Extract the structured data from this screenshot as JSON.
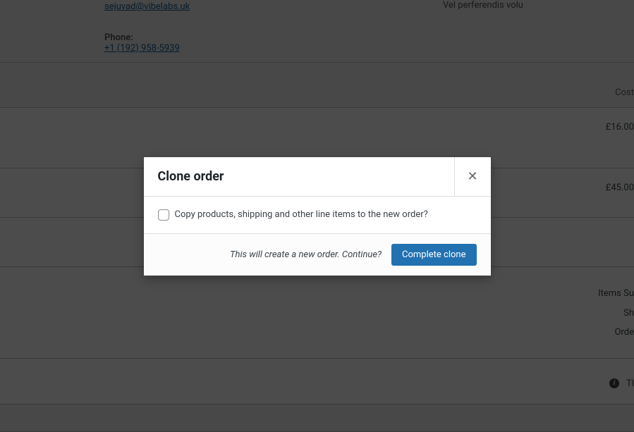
{
  "contact": {
    "email": "sejuvad@vibelabs.uk",
    "phone_label": "Phone:",
    "phone": "+1 (192) 958-5939",
    "note": "Vel perferendis volu"
  },
  "table": {
    "cost_header": "Cost",
    "price1": "£16.00",
    "price2": "£45.00"
  },
  "summary": {
    "line1": "Items Su",
    "line2": "Sh",
    "line3": "Orde"
  },
  "footer": {
    "text": "Tl"
  },
  "modal": {
    "title": "Clone order",
    "checkbox_label": "Copy products, shipping and other line items to the new order?",
    "footer_text": "This will create a new order. Continue?",
    "button": "Complete clone"
  }
}
